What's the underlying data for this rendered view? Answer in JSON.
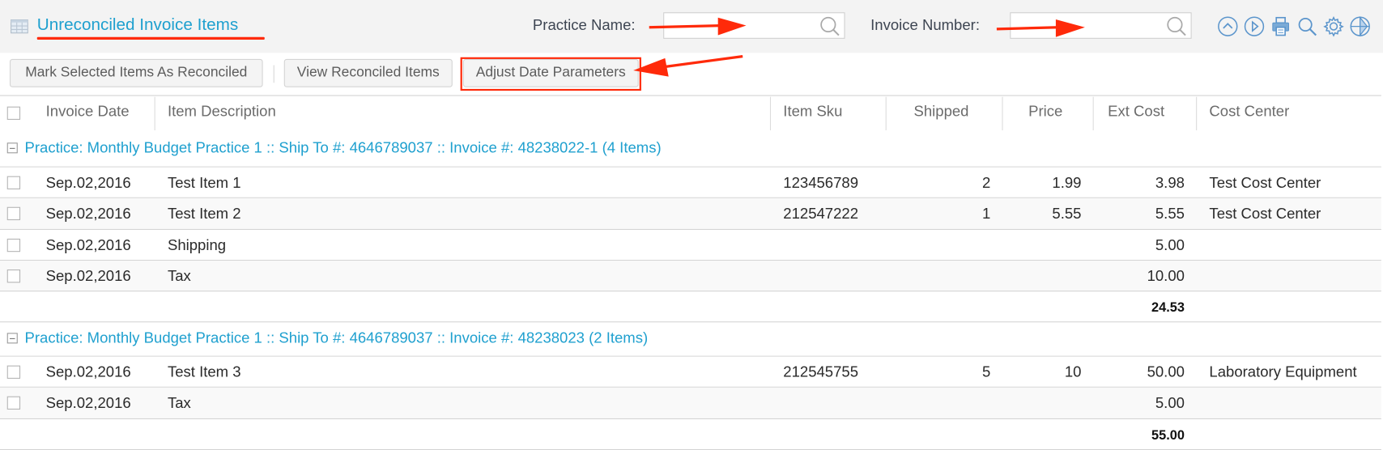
{
  "header": {
    "title": "Unreconciled Invoice Items",
    "filters": [
      {
        "label": "Practice Name:",
        "value": "",
        "placeholder": ""
      },
      {
        "label": "Invoice Number:",
        "value": "",
        "placeholder": ""
      }
    ],
    "tool_icons": [
      "chevron-up-circle-icon",
      "play-circle-icon",
      "print-icon",
      "search-icon",
      "gear-icon",
      "compass-icon"
    ]
  },
  "toolbar": {
    "mark_reconciled_label": "Mark Selected Items As Reconciled",
    "view_reconciled_label": "View Reconciled Items",
    "adjust_dates_label": "Adjust Date Parameters"
  },
  "annotations": {
    "color": "#ff2a0a",
    "highlighted": [
      "page-title",
      "practice-name-input",
      "invoice-number-input",
      "adjust-date-parameters-button"
    ]
  },
  "table": {
    "columns": [
      "Invoice Date",
      "Item Description",
      "Item Sku",
      "Shipped",
      "Price",
      "Ext Cost",
      "Cost Center"
    ],
    "groups": [
      {
        "label": "Practice: Monthly Budget Practice 1 :: Ship To #: 4646789037 :: Invoice #: 48238022-1 (4 Items)",
        "rows": [
          {
            "date": "Sep.02,2016",
            "description": "Test Item 1",
            "sku": "123456789",
            "shipped": "2",
            "price": "1.99",
            "ext_cost": "3.98",
            "cost_center": "Test Cost Center"
          },
          {
            "date": "Sep.02,2016",
            "description": "Test Item 2",
            "sku": "212547222",
            "shipped": "1",
            "price": "5.55",
            "ext_cost": "5.55",
            "cost_center": "Test Cost Center"
          },
          {
            "date": "Sep.02,2016",
            "description": "Shipping",
            "sku": "",
            "shipped": "",
            "price": "",
            "ext_cost": "5.00",
            "cost_center": ""
          },
          {
            "date": "Sep.02,2016",
            "description": "Tax",
            "sku": "",
            "shipped": "",
            "price": "",
            "ext_cost": "10.00",
            "cost_center": ""
          }
        ],
        "total": "24.53"
      },
      {
        "label": "Practice: Monthly Budget Practice 1 :: Ship To #: 4646789037 :: Invoice #: 48238023 (2 Items)",
        "rows": [
          {
            "date": "Sep.02,2016",
            "description": "Test Item 3",
            "sku": "212545755",
            "shipped": "5",
            "price": "10",
            "ext_cost": "50.00",
            "cost_center": "Laboratory Equipment"
          },
          {
            "date": "Sep.02,2016",
            "description": "Tax",
            "sku": "",
            "shipped": "",
            "price": "",
            "ext_cost": "5.00",
            "cost_center": ""
          }
        ],
        "total": "55.00"
      }
    ]
  }
}
